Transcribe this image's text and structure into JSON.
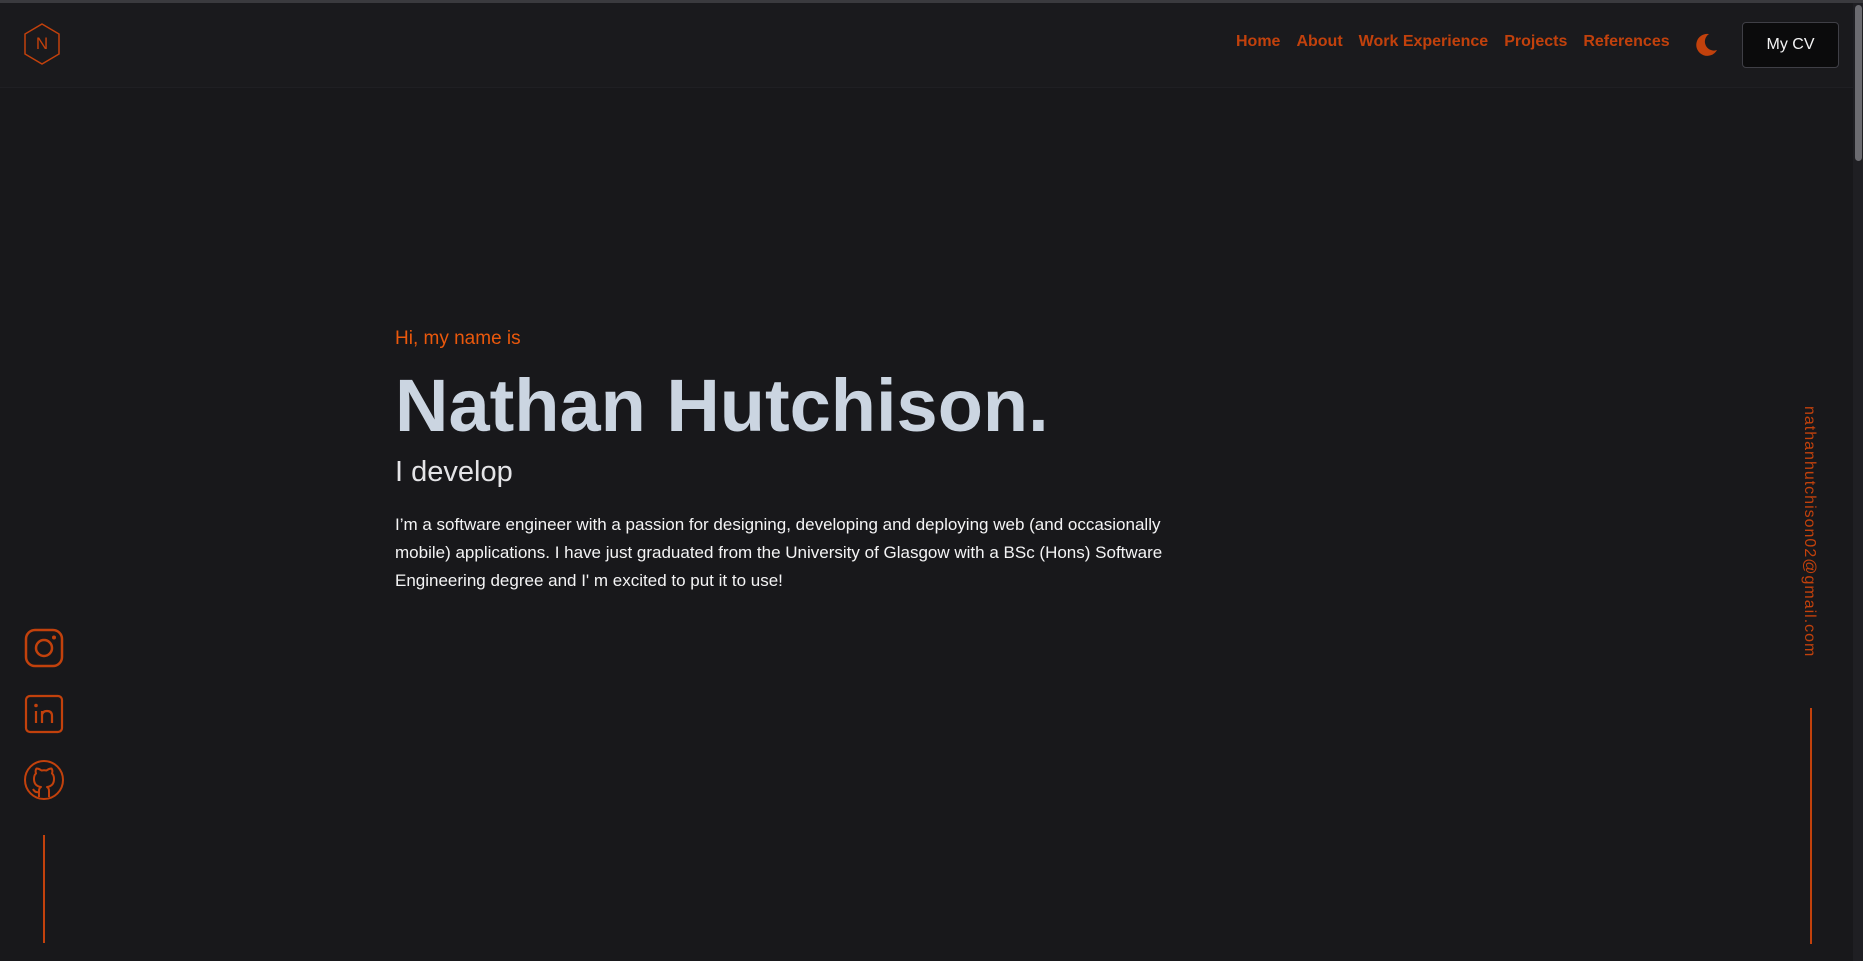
{
  "navbar": {
    "logo_letter": "N",
    "links": [
      "Home",
      "About",
      "Work Experience",
      "Projects",
      "References"
    ],
    "theme_toggle_icon": "moon-icon",
    "cv_button": "My CV"
  },
  "hero": {
    "greeting": "Hi, my name is",
    "name": "Nathan Hutchison.",
    "tagline": "I develop",
    "bio": "I’m a software engineer with a passion for designing, developing and deploying web (and occasionally mobile) applications. I have just graduated from the University of Glasgow with a BSc (Hons) Software Engineering degree and I' m excited to put it to use!"
  },
  "socials": {
    "icons": [
      "instagram-icon",
      "linkedin-icon",
      "github-icon"
    ]
  },
  "email": "nathanhutchison02@gmail.com",
  "colors": {
    "accent": "#c2410c",
    "greeting": "#ea580c",
    "name": "#cbd5e1",
    "background": "#18181b"
  }
}
